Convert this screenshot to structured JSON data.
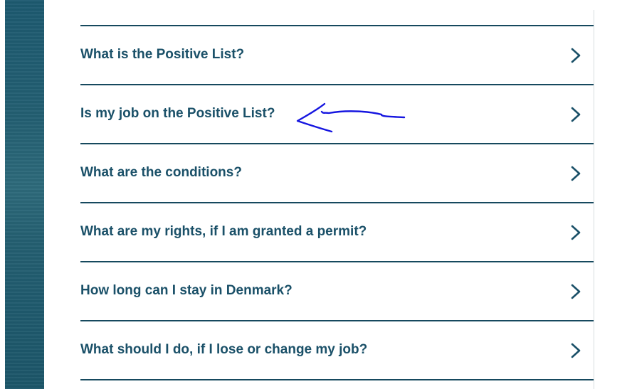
{
  "faq": {
    "items": [
      {
        "question": "What is the Positive List?"
      },
      {
        "question": "Is my job on the Positive List?"
      },
      {
        "question": "What are the conditions?"
      },
      {
        "question": "What are my rights, if I am granted a permit?"
      },
      {
        "question": "How long can I stay in Denmark?"
      },
      {
        "question": "What should I do, if I lose or change my job?"
      }
    ]
  },
  "icons": {
    "item_chevron": "chevron-right-icon",
    "annotation": "hand-drawn-arrow"
  },
  "colors": {
    "text": "#1a5068",
    "divider": "#16495e",
    "annotation": "#1515e0",
    "side_image": "#1f5a6d"
  }
}
